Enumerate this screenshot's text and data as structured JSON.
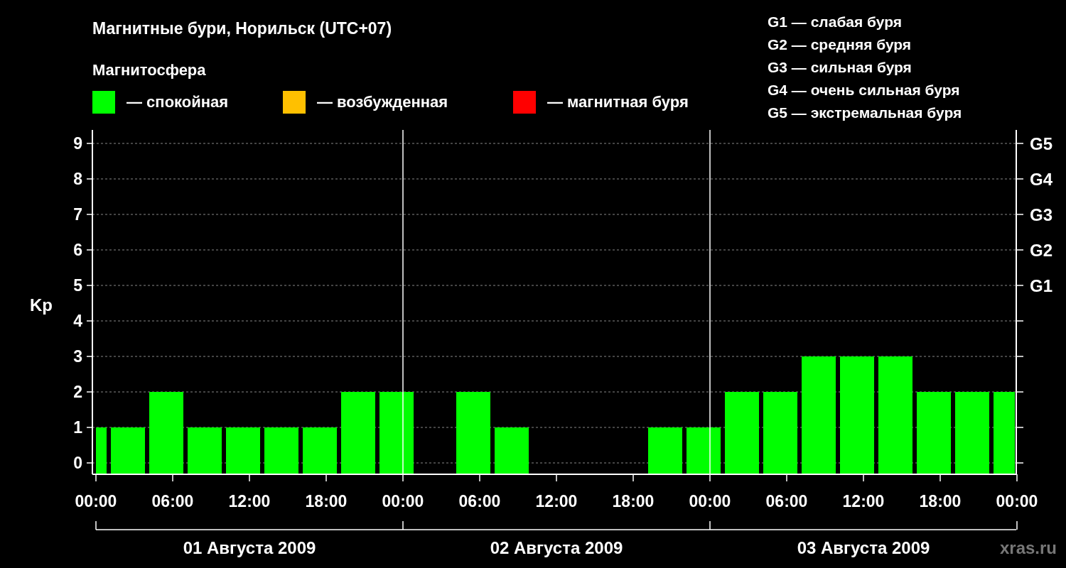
{
  "title": "Магнитные бури, Норильск (UTC+07)",
  "legend_title": "Магнитосфера",
  "legend": [
    {
      "label": "— спокойная",
      "color": "#00ff00"
    },
    {
      "label": "— возбужденная",
      "color": "#ffc000"
    },
    {
      "label": "— магнитная буря",
      "color": "#ff0000"
    }
  ],
  "storm_scale": [
    "G1 — слабая буря",
    "G2 — средняя буря",
    "G3 — сильная буря",
    "G4 — очень сильная буря",
    "G5 — экстремальная буря"
  ],
  "chart_data": {
    "type": "bar",
    "ylabel": "Kp",
    "ylim": [
      0,
      9
    ],
    "yticks": [
      0,
      1,
      2,
      3,
      4,
      5,
      6,
      7,
      8,
      9
    ],
    "xlim": [
      "2009-08-01T00:00",
      "2009-08-04T00:00"
    ],
    "xticks": [
      {
        "value": "2009-08-01T00:00",
        "label": "00:00"
      },
      {
        "value": "2009-08-01T06:00",
        "label": "06:00"
      },
      {
        "value": "2009-08-01T12:00",
        "label": "12:00"
      },
      {
        "value": "2009-08-01T18:00",
        "label": "18:00"
      },
      {
        "value": "2009-08-02T00:00",
        "label": "00:00"
      },
      {
        "value": "2009-08-02T06:00",
        "label": "06:00"
      },
      {
        "value": "2009-08-02T12:00",
        "label": "12:00"
      },
      {
        "value": "2009-08-02T18:00",
        "label": "18:00"
      },
      {
        "value": "2009-08-03T00:00",
        "label": "00:00"
      },
      {
        "value": "2009-08-03T06:00",
        "label": "06:00"
      },
      {
        "value": "2009-08-03T12:00",
        "label": "12:00"
      },
      {
        "value": "2009-08-03T18:00",
        "label": "18:00"
      },
      {
        "value": "2009-08-04T00:00",
        "label": "00:00"
      }
    ],
    "grid": true,
    "x": [
      "2009-08-01T00:30",
      "2009-08-01T02:30",
      "2009-08-01T05:30",
      "2009-08-01T08:30",
      "2009-08-01T11:30",
      "2009-08-01T14:30",
      "2009-08-01T17:30",
      "2009-08-01T20:30",
      "2009-08-01T23:30",
      "2009-08-02T02:30",
      "2009-08-02T05:30",
      "2009-08-02T08:30",
      "2009-08-02T11:30",
      "2009-08-02T14:30",
      "2009-08-02T17:30",
      "2009-08-02T20:30",
      "2009-08-02T23:30",
      "2009-08-03T02:30",
      "2009-08-03T05:30",
      "2009-08-03T08:30",
      "2009-08-03T11:30",
      "2009-08-03T14:30",
      "2009-08-03T17:30",
      "2009-08-03T20:30",
      "2009-08-03T23:00"
    ],
    "series": [
      {
        "color": "#00ff00",
        "values": [
          1,
          1,
          2,
          1,
          1,
          1,
          1,
          2,
          2,
          null,
          2,
          1,
          null,
          null,
          null,
          1,
          1,
          2,
          2,
          3,
          3,
          3,
          2,
          2,
          2
        ]
      }
    ]
  },
  "storm_levels": [
    "G5",
    "G4",
    "G3",
    "G2",
    "G1"
  ],
  "days": [
    "01 Августа 2009",
    "02 Августа 2009",
    "03 Августа 2009"
  ],
  "source": "xras.ru"
}
